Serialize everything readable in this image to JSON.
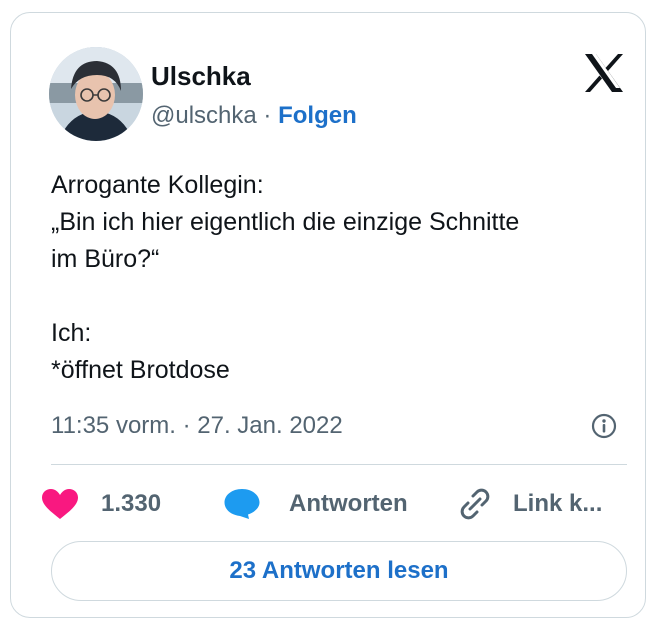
{
  "author": {
    "name": "Ulschka",
    "handle": "@ulschka",
    "separator": "·",
    "follow_label": "Folgen"
  },
  "tweet": {
    "text": "Arrogante Kollegin:\n„Bin ich hier eigentlich die einzige Schnitte\nim Büro?“\n\nIch:\n*öffnet Brotdose",
    "timestamp": "11:35 vorm. · 27. Jan. 2022"
  },
  "actions": {
    "likes": "1.330",
    "reply_label": "Antworten",
    "link_label": "Link k..."
  },
  "read_replies_label": "23 Antworten lesen",
  "icons": {
    "brand": "x-logo-icon",
    "info": "info-icon",
    "like": "heart-icon",
    "reply": "speech-bubble-icon",
    "copy_link": "link-icon"
  },
  "colors": {
    "accent_blue": "#1d70c9",
    "heart_pink": "#f91880",
    "reply_blue": "#1d9bf0",
    "secondary_text": "#536471",
    "border": "#cfd9de"
  }
}
